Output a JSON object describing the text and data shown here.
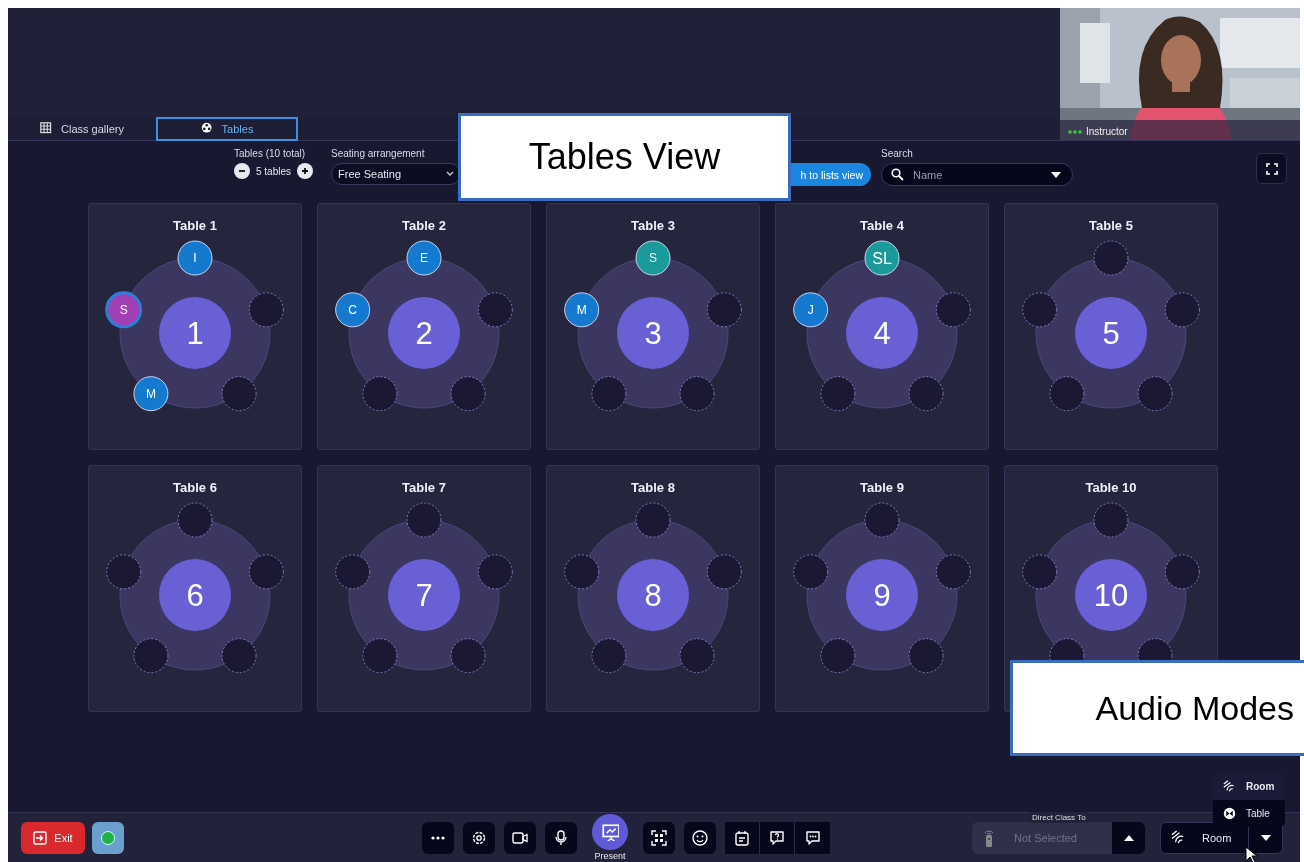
{
  "video_tile": {
    "kind": "picture",
    "name": "Instructor"
  },
  "tabs": [
    {
      "label": "Class gallery",
      "selected": false
    },
    {
      "label": "Tables",
      "selected": true
    }
  ],
  "toolbar": {
    "tables_label": "Tables (10 total)",
    "tables_count": "5 tables",
    "seating_label": "Seating arrangement",
    "seating_value": "Free Seating",
    "switch_button": "h to lists view",
    "search_label": "Search",
    "search_placeholder": "Name"
  },
  "tables": [
    {
      "title": "Table 1",
      "number": "1",
      "seats": [
        {
          "occupied": true,
          "initials": "I",
          "color": "#1479cf",
          "selected": false
        },
        {
          "occupied": false,
          "selected": false
        },
        {
          "occupied": false,
          "selected": false
        },
        {
          "occupied": true,
          "initials": "M",
          "color": "#1479cf",
          "selected": false
        },
        {
          "occupied": true,
          "initials": "S",
          "color": "#a040b4",
          "selected": true
        }
      ]
    },
    {
      "title": "Table 2",
      "number": "2",
      "seats": [
        {
          "occupied": true,
          "initials": "E",
          "color": "#1479cf",
          "selected": false
        },
        {
          "occupied": false,
          "selected": false
        },
        {
          "occupied": false,
          "selected": false
        },
        {
          "occupied": false,
          "selected": false
        },
        {
          "occupied": true,
          "initials": "C",
          "color": "#1479cf",
          "selected": false
        }
      ]
    },
    {
      "title": "Table 3",
      "number": "3",
      "seats": [
        {
          "occupied": true,
          "initials": "S",
          "color": "#1a9a9a",
          "selected": false
        },
        {
          "occupied": false,
          "selected": false
        },
        {
          "occupied": false,
          "selected": false
        },
        {
          "occupied": false,
          "selected": false
        },
        {
          "occupied": true,
          "initials": "M",
          "color": "#1479cf",
          "selected": false
        }
      ]
    },
    {
      "title": "Table 4",
      "number": "4",
      "seats": [
        {
          "occupied": true,
          "initials": "SL",
          "color": "#1a9a9a",
          "selected": false
        },
        {
          "occupied": false,
          "selected": false
        },
        {
          "occupied": false,
          "selected": false
        },
        {
          "occupied": false,
          "selected": false
        },
        {
          "occupied": true,
          "initials": "J",
          "color": "#1479cf",
          "selected": false
        }
      ]
    },
    {
      "title": "Table 5",
      "number": "5",
      "seats": [
        {
          "occupied": false,
          "selected": false
        },
        {
          "occupied": false,
          "selected": false
        },
        {
          "occupied": false,
          "selected": false
        },
        {
          "occupied": false,
          "selected": false
        },
        {
          "occupied": false,
          "selected": false
        }
      ]
    },
    {
      "title": "Table 6",
      "number": "6",
      "seats": [
        {
          "occupied": false,
          "selected": false
        },
        {
          "occupied": false,
          "selected": false
        },
        {
          "occupied": false,
          "selected": false
        },
        {
          "occupied": false,
          "selected": false
        },
        {
          "occupied": false,
          "selected": false
        }
      ]
    },
    {
      "title": "Table 7",
      "number": "7",
      "seats": [
        {
          "occupied": false,
          "selected": false
        },
        {
          "occupied": false,
          "selected": false
        },
        {
          "occupied": false,
          "selected": false
        },
        {
          "occupied": false,
          "selected": false
        },
        {
          "occupied": false,
          "selected": false
        }
      ]
    },
    {
      "title": "Table 8",
      "number": "8",
      "seats": [
        {
          "occupied": false,
          "selected": false
        },
        {
          "occupied": false,
          "selected": false
        },
        {
          "occupied": false,
          "selected": false
        },
        {
          "occupied": false,
          "selected": false
        },
        {
          "occupied": false,
          "selected": false
        }
      ]
    },
    {
      "title": "Table 9",
      "number": "9",
      "seats": [
        {
          "occupied": false,
          "selected": false
        },
        {
          "occupied": false,
          "selected": false
        },
        {
          "occupied": false,
          "selected": false
        },
        {
          "occupied": false,
          "selected": false
        },
        {
          "occupied": false,
          "selected": false
        }
      ]
    },
    {
      "title": "Table 10",
      "number": "10",
      "seats": [
        {
          "occupied": false,
          "selected": false
        },
        {
          "occupied": false,
          "selected": false
        },
        {
          "occupied": false,
          "selected": false
        },
        {
          "occupied": false,
          "selected": false
        },
        {
          "occupied": false,
          "selected": false
        }
      ]
    }
  ],
  "callouts": [
    {
      "text": "Tables View",
      "kind": "top"
    },
    {
      "text": "Audio Modes",
      "kind": "right"
    }
  ],
  "bottom_bar": {
    "exit": "Exit",
    "status": {
      "color": "#22b04a"
    },
    "tools": [
      {
        "kind": "more"
      },
      {
        "kind": "settings"
      },
      {
        "kind": "camera"
      },
      {
        "kind": "mic"
      },
      {
        "kind": "present",
        "label": "Present"
      },
      {
        "kind": "scan"
      },
      {
        "kind": "emoji"
      },
      {
        "kind": "notes"
      },
      {
        "kind": "question"
      },
      {
        "kind": "chat"
      }
    ],
    "direct_label": "Direct Class To",
    "direct_value": "Not Selected",
    "direct_disabled": true,
    "mode_value": "Room",
    "mode_menu": [
      {
        "label": "Room",
        "selected": true
      },
      {
        "label": "Table",
        "selected": false
      }
    ]
  }
}
